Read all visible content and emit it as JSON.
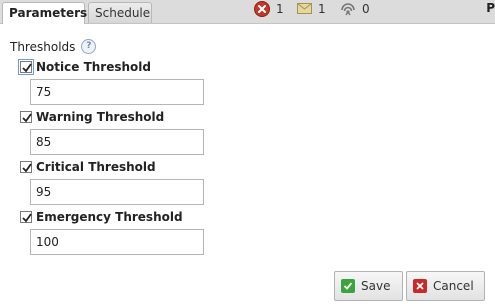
{
  "tabs": [
    {
      "label": "Parameters",
      "active": true
    },
    {
      "label": "Schedule",
      "active": false
    }
  ],
  "status": {
    "errors_count": "1",
    "mail_count": "1",
    "feeds_count": "0",
    "corner_letter": "P"
  },
  "thresholds": {
    "title": "Thresholds",
    "help_icon": "?",
    "fields": [
      {
        "label": "Notice Threshold",
        "value": "75",
        "checked": true
      },
      {
        "label": "Warning Threshold",
        "value": "85",
        "checked": true
      },
      {
        "label": "Critical Threshold",
        "value": "95",
        "checked": true
      },
      {
        "label": "Emergency Threshold",
        "value": "100",
        "checked": true
      }
    ]
  },
  "buttons": {
    "save_label": "Save",
    "cancel_label": "Cancel"
  },
  "colors": {
    "save_icon": "#3aa53a",
    "cancel_icon": "#c82a2a",
    "error_icon": "#c0392b"
  },
  "icons": {
    "errors": "error-icon",
    "mail": "mail-icon",
    "feeds": "feed-icon",
    "save": "check-icon",
    "cancel": "close-icon",
    "help": "help-icon"
  }
}
